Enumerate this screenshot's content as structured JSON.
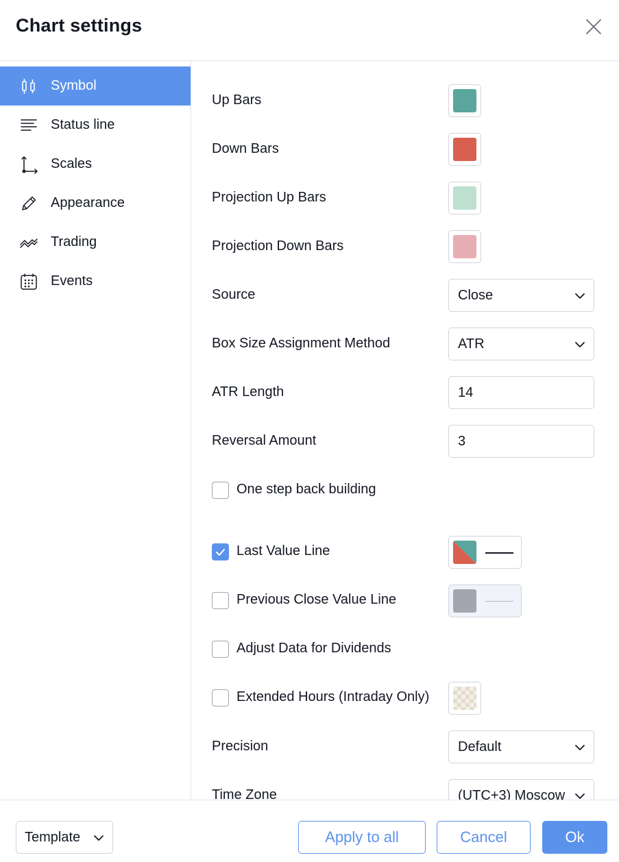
{
  "dialog": {
    "title": "Chart settings"
  },
  "sidebar": {
    "items": [
      {
        "label": "Symbol",
        "icon": "candles-icon",
        "active": true
      },
      {
        "label": "Status line",
        "icon": "lines-icon",
        "active": false
      },
      {
        "label": "Scales",
        "icon": "axes-icon",
        "active": false
      },
      {
        "label": "Appearance",
        "icon": "pencil-icon",
        "active": false
      },
      {
        "label": "Trading",
        "icon": "trading-icon",
        "active": false
      },
      {
        "label": "Events",
        "icon": "calendar-icon",
        "active": false
      }
    ]
  },
  "symbol": {
    "up_bars": {
      "label": "Up Bars",
      "color": "#5aa69c"
    },
    "down_bars": {
      "label": "Down Bars",
      "color": "#d96050"
    },
    "proj_up_bars": {
      "label": "Projection Up Bars",
      "color": "#bde0d0"
    },
    "proj_down_bars": {
      "label": "Projection Down Bars",
      "color": "#e8adb2"
    },
    "source": {
      "label": "Source",
      "value": "Close"
    },
    "box_size": {
      "label": "Box Size Assignment Method",
      "value": "ATR"
    },
    "atr_length": {
      "label": "ATR Length",
      "value": "14"
    },
    "reversal": {
      "label": "Reversal Amount",
      "value": "3"
    },
    "one_step_back": {
      "label": "One step back building",
      "checked": false
    },
    "last_value_line": {
      "label": "Last Value Line",
      "checked": true
    },
    "prev_close_line": {
      "label": "Previous Close Value Line",
      "checked": false,
      "color": "#a3a6af"
    },
    "adjust_dividends": {
      "label": "Adjust Data for Dividends",
      "checked": false
    },
    "extended_hours": {
      "label": "Extended Hours (Intraday Only)",
      "checked": false
    },
    "precision": {
      "label": "Precision",
      "value": "Default"
    },
    "time_zone": {
      "label": "Time Zone",
      "value": "(UTC+3) Moscow"
    }
  },
  "footer": {
    "template_label": "Template",
    "apply_all_label": "Apply to all",
    "cancel_label": "Cancel",
    "ok_label": "Ok"
  },
  "colors": {
    "accent": "#5b93ec",
    "border": "#d1d4dc",
    "text": "#131722"
  }
}
